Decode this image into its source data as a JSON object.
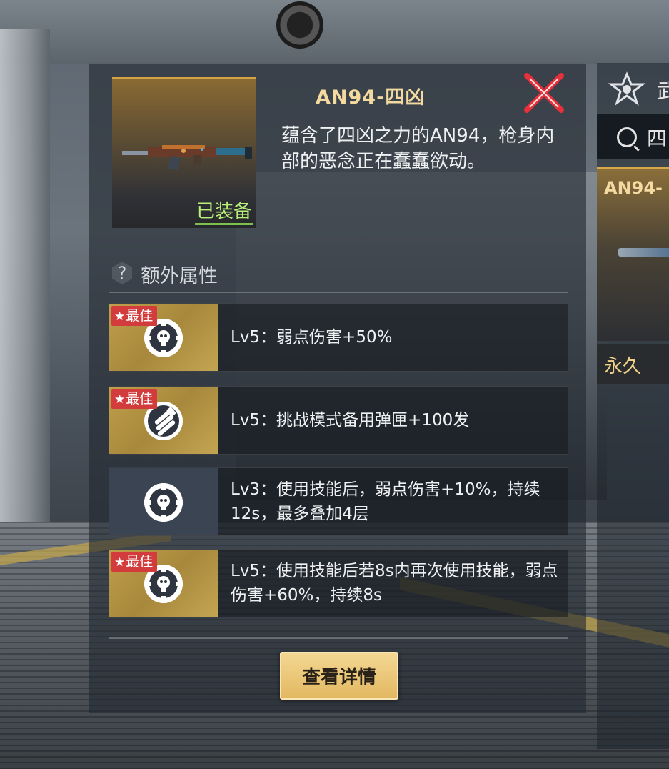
{
  "item": {
    "name": "AN94-四凶",
    "description": "蕴含了四凶之力的AN94，枪身内部的恶念正在蠢蠢欲动。",
    "equipped_label": "已装备"
  },
  "attributes_section": {
    "help_icon": "?",
    "title": "额外属性"
  },
  "attributes": [
    {
      "best": true,
      "best_label": "最佳",
      "icon": "crosshair-skull-icon",
      "text": "Lv5：弱点伤害+50%"
    },
    {
      "best": true,
      "best_label": "最佳",
      "icon": "ammo-clip-icon",
      "text": "Lv5：挑战模式备用弹匣+100发"
    },
    {
      "best": false,
      "best_label": "",
      "icon": "crosshair-skull-icon",
      "text": "Lv3：使用技能后，弱点伤害+10%，持续12s，最多叠加4层"
    },
    {
      "best": true,
      "best_label": "最佳",
      "icon": "crosshair-skull-icon",
      "text": "Lv5：使用技能后若8s内再次使用技能，弱点伤害+60%，持续8s"
    }
  ],
  "buttons": {
    "details": "查看详情"
  },
  "side_panel": {
    "rank_text": "武",
    "search_text": "四",
    "card_title": "AN94-",
    "duration": "永久"
  },
  "colors": {
    "gold_accent": "#d3a347",
    "best_tag": "#d23c3c",
    "equipped_green": "#b8f07a"
  }
}
